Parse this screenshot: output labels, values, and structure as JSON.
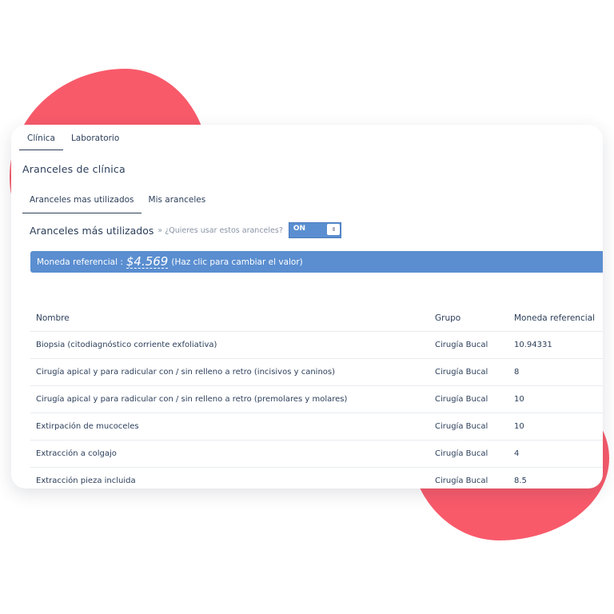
{
  "colors": {
    "accent": "#5a8ed0",
    "blob": "#f85a6a",
    "text": "#2c3e5a"
  },
  "tabs": [
    {
      "label": "Clínica",
      "active": true
    },
    {
      "label": "Laboratorio",
      "active": false
    }
  ],
  "section_title": "Aranceles de clínica",
  "subtabs": [
    {
      "label": "Aranceles mas utilizados",
      "active": true
    },
    {
      "label": "Mis aranceles",
      "active": false
    }
  ],
  "used": {
    "title": "Aranceles más utilizados",
    "question": "» ¿Quieres usar estos aranceles?",
    "toggle_label": "ON",
    "toggle_knob": "III"
  },
  "banner": {
    "label": "Moneda referencial :",
    "value": "$4.569",
    "hint": "(Haz clic para cambiar el valor)"
  },
  "table": {
    "headers": [
      "Nombre",
      "Grupo",
      "Moneda referencial"
    ],
    "rows": [
      [
        "Biopsia (citodiagnóstico corriente exfoliativa)",
        "Cirugía Bucal",
        "10.94331"
      ],
      [
        "Cirugía apical y para radicular con / sin relleno a retro (incisivos y caninos)",
        "Cirugía Bucal",
        "8"
      ],
      [
        "Cirugía apical y para radicular con / sin relleno a retro (premolares y molares)",
        "Cirugía Bucal",
        "10"
      ],
      [
        "Extirpación de mucoceles",
        "Cirugía Bucal",
        "10"
      ],
      [
        "Extracción a colgajo",
        "Cirugía Bucal",
        "4"
      ],
      [
        "Extracción pieza incluida",
        "Cirugía Bucal",
        "8.5"
      ]
    ]
  }
}
